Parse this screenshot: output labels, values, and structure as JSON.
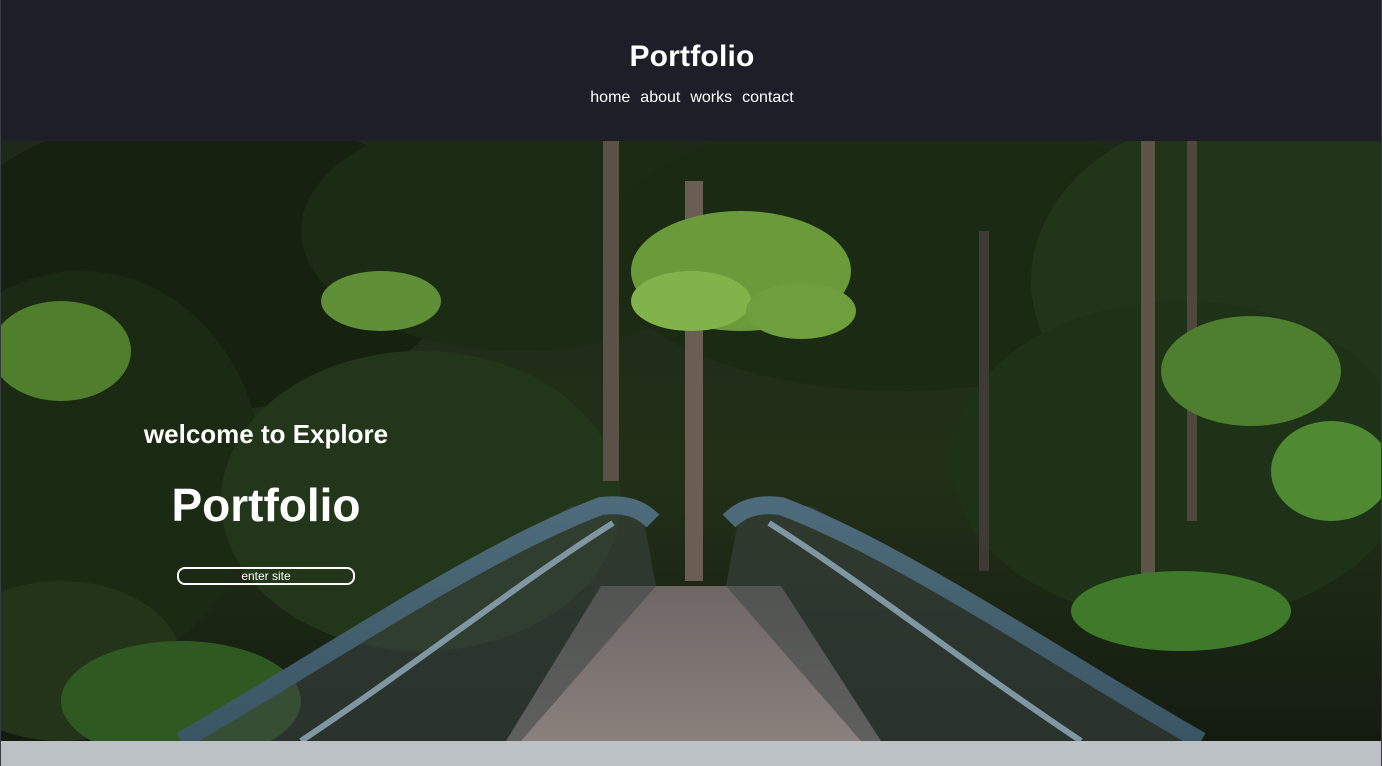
{
  "header": {
    "title": "Portfolio",
    "nav": [
      {
        "label": "home"
      },
      {
        "label": "about"
      },
      {
        "label": "works"
      },
      {
        "label": "contact"
      }
    ]
  },
  "hero": {
    "heading": "welcome to Explore",
    "title": "Portfolio",
    "button_label": "enter site"
  },
  "colors": {
    "header_bg": "#1e1e28",
    "text": "#ffffff"
  }
}
